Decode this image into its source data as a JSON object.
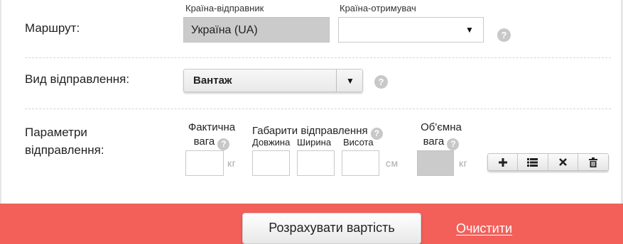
{
  "route": {
    "label": "Маршрут:",
    "sender_label": "Країна-відправник",
    "sender_value": "Україна (UA)",
    "receiver_label": "Країна-отримувач",
    "receiver_value": ""
  },
  "shipment_type": {
    "label": "Вид відправлення:",
    "value": "Вантаж"
  },
  "params": {
    "label_line1": "Параметри",
    "label_line2": "відправлення:",
    "actual_weight_line1": "Фактична",
    "actual_weight_line2": "вага",
    "weight_unit": "кг",
    "dimensions_label": "Габарити відправлення",
    "length_label": "Довжина",
    "width_label": "Ширина",
    "height_label": "Висота",
    "dimensions_unit": "см",
    "volume_weight_line1": "Об'ємна",
    "volume_weight_line2": "вага",
    "volume_unit": "кг"
  },
  "help_glyph": "?",
  "icons": [
    "plus-icon",
    "list-icon",
    "close-icon",
    "trash-icon",
    "help-icon",
    "chevron-down-icon"
  ],
  "colors": {
    "footer_bg": "#f3605a",
    "disabled_field": "#cbcbcb"
  },
  "footer": {
    "calculate_label": "Розрахувати вартість",
    "clear_label": "Очистити"
  }
}
